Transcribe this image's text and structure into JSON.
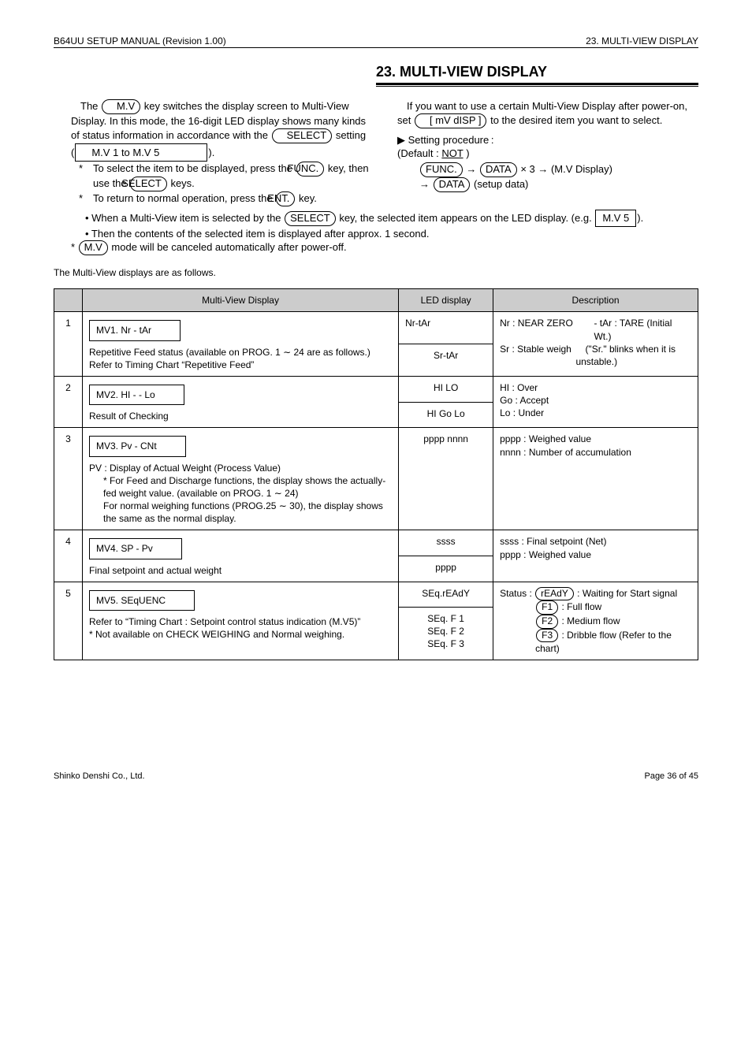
{
  "header": {
    "left": "B64UU SETUP MANUAL (Revision 1.00)",
    "right": "23. MULTI-VIEW DISPLAY"
  },
  "section": {
    "title": "23. MULTI-VIEW DISPLAY"
  },
  "left_col": {
    "p1_a": "The ",
    "p1_b": "M.V",
    "p1_c": " key switches the display screen to Multi-View Display. In this mode, the 16-digit LED display shows many kinds of status information in accordance with the ",
    "p1_d": "SELECT",
    "p1_e": " setting (",
    "p1_f": "M.V 1",
    "p1_g": "to",
    "p1_h": "M.V 5",
    "p1_i": ").",
    "p2_a": "To select the item to be displayed, press the ",
    "p2_key1": "FUNC.",
    "p2_b": " key, then use the ",
    "p2_c": "SELECT",
    "p2_d": " keys.",
    "p3_a": "To return to normal operation, press the ",
    "p3_key1": "ENT.",
    "p3_b": " key.",
    "p4_a": "• When a Multi-View item is selected by the ",
    "p4_key1": "SELECT",
    "p4_b": " key, the selected item appears on the LED display. (e.g. ",
    "p4_c": "M.V 5",
    "p4_d": ").",
    "p5": "• Then the contents of the selected item is displayed after approx. 1 second.",
    "p6_a": "* ",
    "p6_key1": "M.V",
    "p6_b": " mode will be canceled automatically after power-off."
  },
  "right_col": {
    "p1_a": "If you want to use a certain Multi-View Display after power-on, set ",
    "p1_key1": "[ mV dISP  ]",
    "p1_b": " to the desired item you want to select.",
    "sub_a": "▶ Setting procedure :",
    "sub_b": "      (Default : ",
    "sub_c": "NOT",
    "sub_d": " )",
    "sub_key1": "FUNC.",
    "sub_key2": "DATA",
    "sub_e": " × 3 → (M.V Display)",
    "sub_f": "→ ",
    "sub_g": "(setup data)"
  },
  "table_intro": "The Multi-View displays are as follows.",
  "table": {
    "headers": {
      "c1": "",
      "c2": "Multi-View Display",
      "c3": "LED display",
      "c4": "Description"
    },
    "rows": [
      {
        "num": "1",
        "box": "MV1. Nr - tAr",
        "prog_lines": [
          "Repetitive Feed status (available on PROG. 1 ∼ 24 are as follows.)",
          "Refer to Timing Chart “Repetitive Feed”"
        ],
        "disp": "Nr-tAr",
        "disp2": "Sr-tAr",
        "desc_list": [
          {
            "pre": "Nr : NEAR ZERO",
            "post": "- tAr : TARE (Initial Wt.)"
          },
          {
            "pre": "Sr : Stable weigh",
            "post": " (\"Sr.\" blinks when it is unstable.)"
          }
        ]
      },
      {
        "num": "2",
        "box": "MV2. HI - - Lo",
        "prog_lines": [
          "Result of Checking"
        ],
        "disp": "HI    LO",
        "disp2": "HI Go Lo",
        "desc_list": [
          {
            "pre": "HI : Over",
            "post": ""
          },
          {
            "pre": "Go : Accept",
            "post": ""
          },
          {
            "pre": "Lo : Under",
            "post": ""
          }
        ]
      },
      {
        "num": "3",
        "box": "MV3. Pv - CNt",
        "prog_lines": [
          "PV : Display of Actual Weight (Process Value)",
          "* For Feed and Discharge functions, the display shows the actually-fed weight value. (available on PROG. 1 ∼ 24)",
          "For normal weighing functions (PROG.25 ∼ 30), the display shows the same as the normal display."
        ],
        "disp": "pppp nnnn",
        "desc_list": [
          {
            "pre": "pppp : Weighed value",
            "post": ""
          },
          {
            "pre": "nnnn : Number of accumulation",
            "post": ""
          }
        ]
      },
      {
        "num": "4",
        "box": "MV4. SP - Pv",
        "prog_lines": [
          "Final setpoint and actual weight"
        ],
        "disp": "ssss",
        "disp2": "pppp",
        "desc_list": [
          {
            "pre": "ssss : Final setpoint (Net)",
            "post": ""
          },
          {
            "pre": "pppp : Weighed value",
            "post": ""
          }
        ]
      },
      {
        "num": "5",
        "box": "MV5. SEqUENC",
        "prog_lines": [
          "Refer to “Timing Chart : Setpoint control status indication (M.V5)”",
          "* Not available on CHECK WEIGHING and Normal weighing."
        ],
        "disp": "SEq.rEAdY",
        "disp2": "SEq. F 1\nSEq. F 2\nSEq. F 3",
        "desc_lead": "Status : ",
        "desc_list2": [
          {
            "pill": "rEAdY",
            "txt": " : Waiting for Start signal"
          },
          {
            "pill": "F1",
            "txt": " : Full flow"
          },
          {
            "pill": "F2",
            "txt": " : Medium flow"
          },
          {
            "pill": "F3",
            "txt": " : Dribble flow (Refer to the chart)"
          }
        ]
      }
    ]
  },
  "footer": {
    "left": "Shinko Denshi Co., Ltd.",
    "right": "Page 36 of 45"
  }
}
